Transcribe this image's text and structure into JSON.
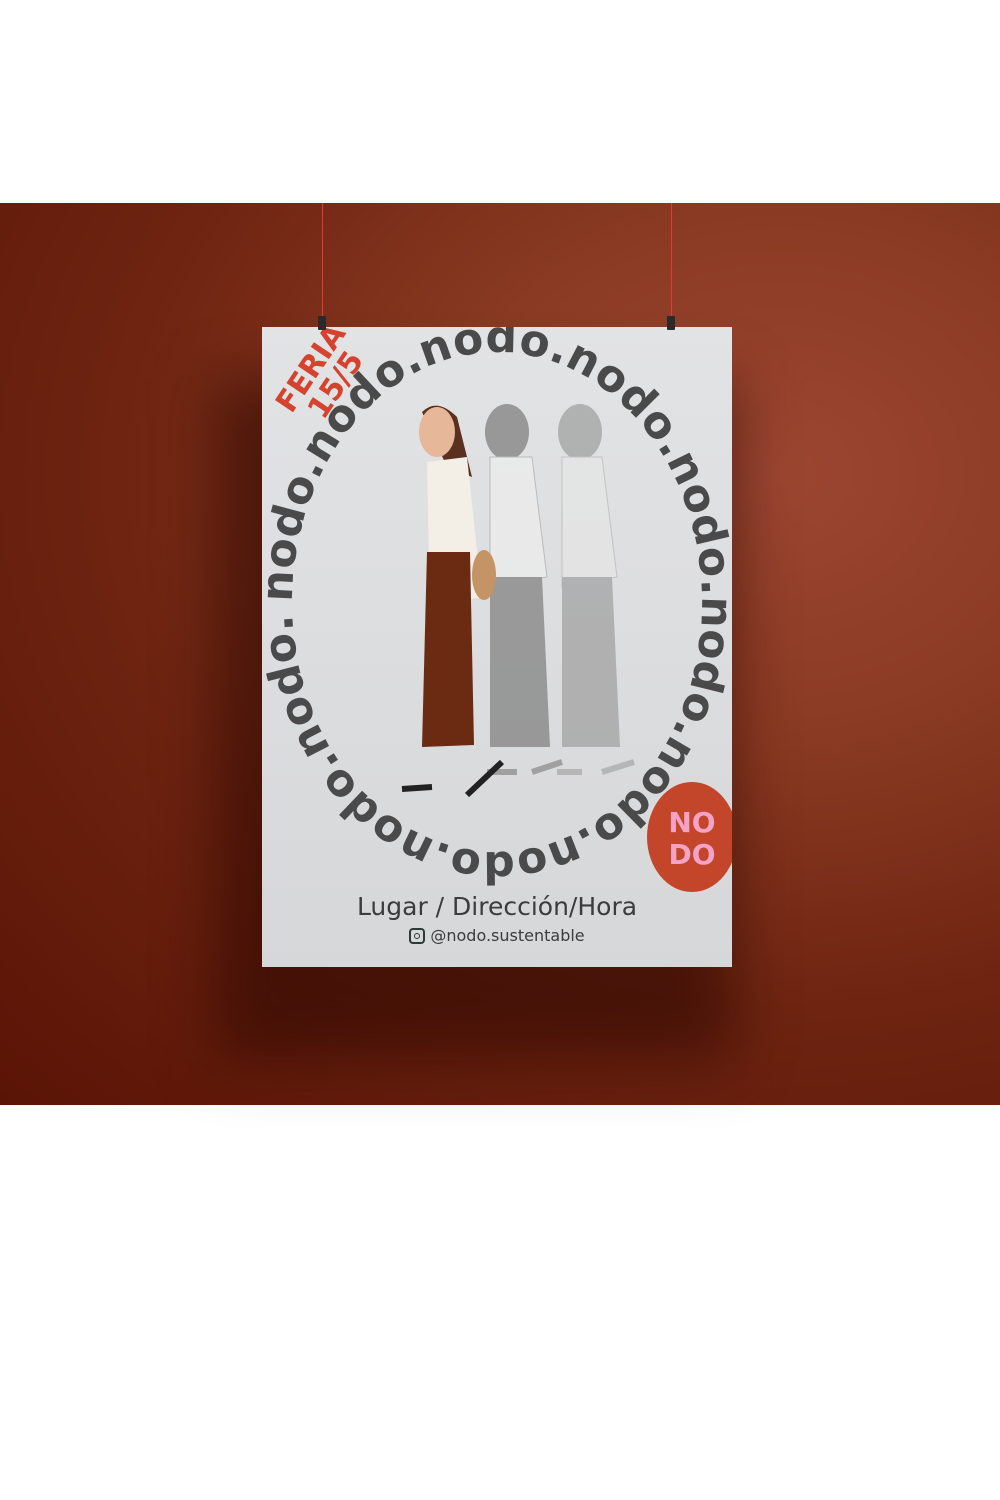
{
  "poster": {
    "event_label": "FERIA",
    "event_date": "15/5",
    "circular_text": "nodo.nodo.nodo.nodo.nodo.nodo.nodo.nodo.nodo.nodo.",
    "logo_text_top": "NO",
    "logo_text_bottom": "DO",
    "place_text": "Lugar / Dirección/Hora",
    "social_handle": "@nodo.sustentable",
    "icons": {
      "social": "instagram-icon"
    }
  },
  "colors": {
    "wall": "#7a2c18",
    "accent": "#d5432e",
    "logo_bg": "#c4462a",
    "logo_letters": "#f2a3c6",
    "text": "#4a4a4a"
  }
}
